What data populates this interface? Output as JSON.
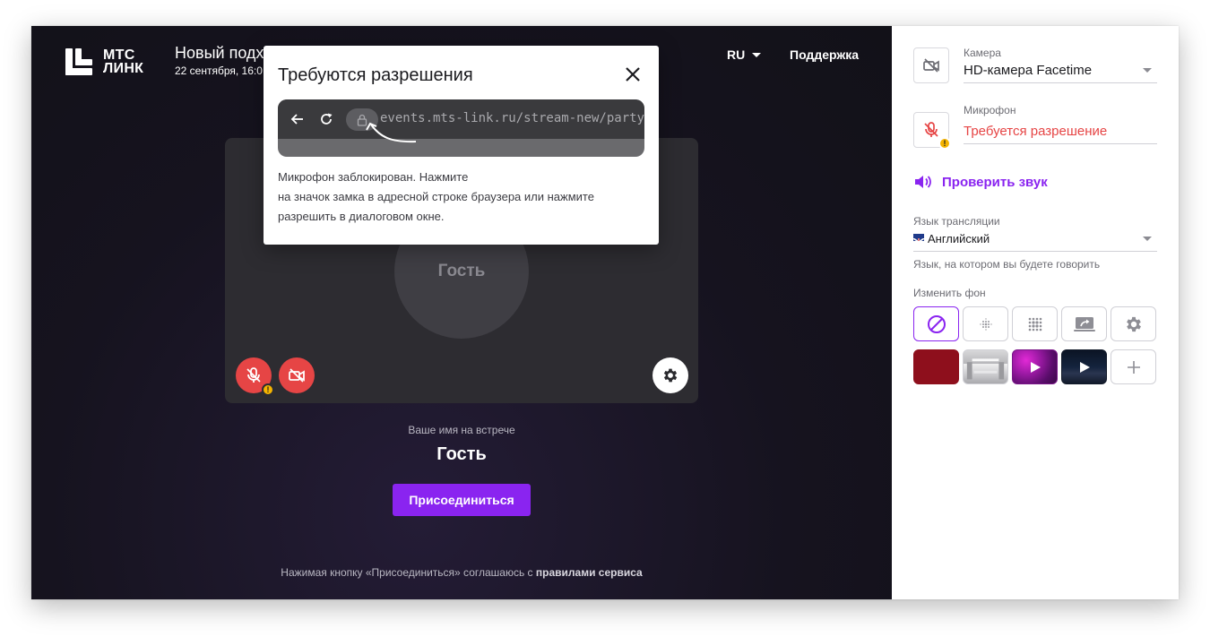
{
  "header": {
    "logo_line1": "МТС",
    "logo_line2": "ЛИНК",
    "meeting_title": "Новый подх",
    "meeting_date": "22 сентября, 16:0",
    "language": "RU",
    "support": "Поддержка"
  },
  "preview": {
    "avatar_name": "Гость"
  },
  "join": {
    "name_label": "Ваше имя на встрече",
    "name_value": "Гость",
    "button": "Присоединиться",
    "terms_text": "Нажимая кнопку «Присоединиться» соглашаюсь с ",
    "terms_link": "правилами сервиса"
  },
  "modal": {
    "title": "Требуются разрешения",
    "url": "events.mts-link.ru/stream-new/party",
    "body_line1": "Микрофон заблокирован. Нажмите",
    "body_line2": "на значок замка в адресной строке браузера или нажмите",
    "body_line3": "разрешить в диалоговом окне."
  },
  "settings": {
    "camera_label": "Камера",
    "camera_value": "HD-камера Facetime",
    "mic_label": "Микрофон",
    "mic_value": "Требуется разрешение",
    "check_sound": "Проверить звук",
    "lang_label": "Язык трансляции",
    "lang_value": "Английский",
    "lang_hint": "Язык, на котором вы будете говорить",
    "bg_label": "Изменить фон"
  },
  "colors": {
    "accent": "#8a24f0",
    "error": "#e64545",
    "warning": "#f5b400"
  },
  "icons": {
    "camera_off": "camera-off-icon",
    "mic_off": "mic-off-icon",
    "gear": "gear-icon",
    "close": "close-icon",
    "lock": "lock-icon",
    "speaker": "speaker-icon",
    "plus": "plus-icon"
  }
}
